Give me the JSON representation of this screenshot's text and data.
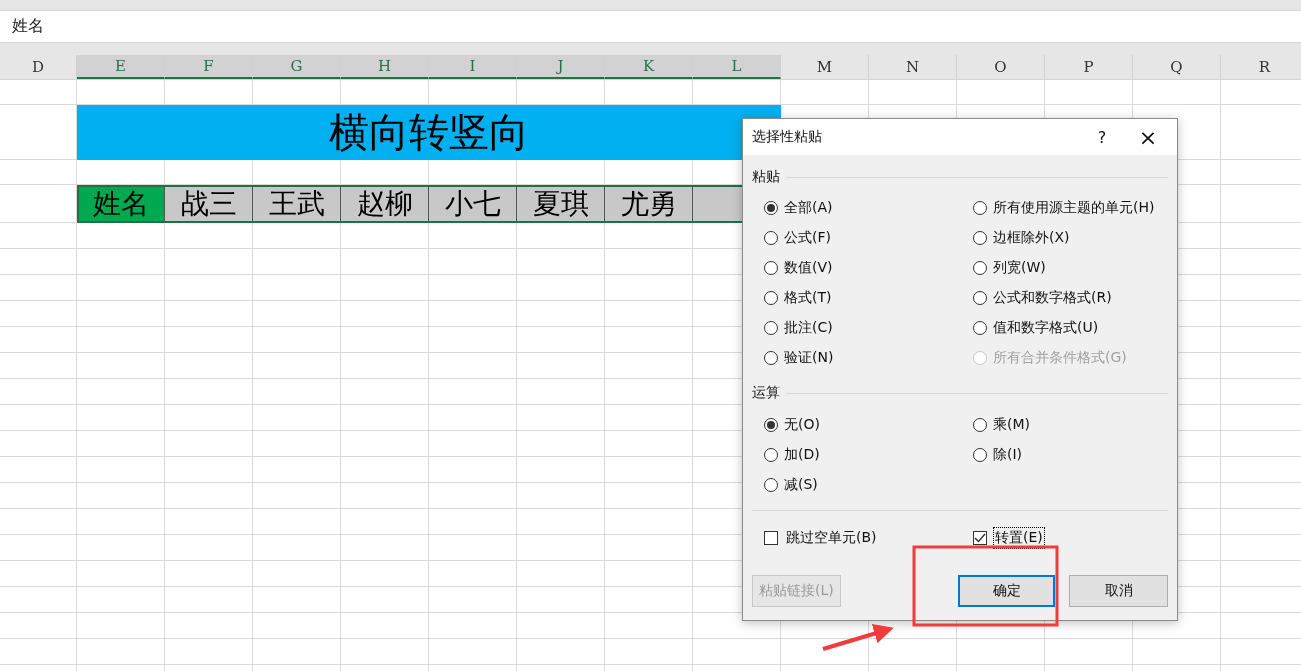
{
  "formula_bar": {
    "value": "姓名"
  },
  "columns": [
    {
      "label": "D",
      "selected": false
    },
    {
      "label": "E",
      "selected": true
    },
    {
      "label": "F",
      "selected": true
    },
    {
      "label": "G",
      "selected": true
    },
    {
      "label": "H",
      "selected": true
    },
    {
      "label": "I",
      "selected": true
    },
    {
      "label": "J",
      "selected": true
    },
    {
      "label": "K",
      "selected": true
    },
    {
      "label": "L",
      "selected": true
    },
    {
      "label": "M",
      "selected": false
    },
    {
      "label": "N",
      "selected": false
    },
    {
      "label": "O",
      "selected": false
    },
    {
      "label": "P",
      "selected": false
    },
    {
      "label": "Q",
      "selected": false
    },
    {
      "label": "R",
      "selected": false
    }
  ],
  "title_cell": {
    "text": "横向转竖向",
    "color": "#00b0f0"
  },
  "name_row": {
    "copied": true,
    "cells": [
      {
        "text": "姓名",
        "color": "#00a94f"
      },
      {
        "text": "战三",
        "color": "#c8c8c8"
      },
      {
        "text": "王武",
        "color": "#c8c8c8"
      },
      {
        "text": "赵柳",
        "color": "#c8c8c8"
      },
      {
        "text": "小七",
        "color": "#c8c8c8"
      },
      {
        "text": "夏琪",
        "color": "#c8c8c8"
      },
      {
        "text": "尤勇",
        "color": "#c8c8c8"
      },
      {
        "color": "#c8c8c8"
      }
    ]
  },
  "dialog": {
    "title": "选择性粘贴",
    "help": "?",
    "close": "×",
    "paste": {
      "heading": "粘贴",
      "options": [
        {
          "label": "全部(A)",
          "selected": true,
          "disabled": false
        },
        {
          "label": "所有使用源主题的单元(H)",
          "selected": false,
          "disabled": false
        },
        {
          "label": "公式(F)",
          "selected": false,
          "disabled": false
        },
        {
          "label": "边框除外(X)",
          "selected": false,
          "disabled": false
        },
        {
          "label": "数值(V)",
          "selected": false,
          "disabled": false
        },
        {
          "label": "列宽(W)",
          "selected": false,
          "disabled": false
        },
        {
          "label": "格式(T)",
          "selected": false,
          "disabled": false
        },
        {
          "label": "公式和数字格式(R)",
          "selected": false,
          "disabled": false
        },
        {
          "label": "批注(C)",
          "selected": false,
          "disabled": false
        },
        {
          "label": "值和数字格式(U)",
          "selected": false,
          "disabled": false
        },
        {
          "label": "验证(N)",
          "selected": false,
          "disabled": false
        },
        {
          "label": "所有合并条件格式(G)",
          "selected": false,
          "disabled": true
        }
      ]
    },
    "operation": {
      "heading": "运算",
      "options": [
        {
          "label": "无(O)",
          "selected": true,
          "disabled": false
        },
        {
          "label": "乘(M)",
          "selected": false,
          "disabled": false
        },
        {
          "label": "加(D)",
          "selected": false,
          "disabled": false
        },
        {
          "label": "除(I)",
          "selected": false,
          "disabled": false
        },
        {
          "label": "减(S)",
          "selected": false,
          "disabled": false
        }
      ]
    },
    "checkboxes": [
      {
        "label": "跳过空单元(B)",
        "checked": false,
        "focused": false
      },
      {
        "label": "转置(E)",
        "checked": true,
        "focused": true
      }
    ],
    "buttons": [
      {
        "label": "粘贴链接(L)",
        "disabled": true,
        "default": false
      },
      {
        "label": "确定",
        "disabled": false,
        "default": true
      },
      {
        "label": "取消",
        "disabled": false,
        "default": false
      }
    ]
  }
}
